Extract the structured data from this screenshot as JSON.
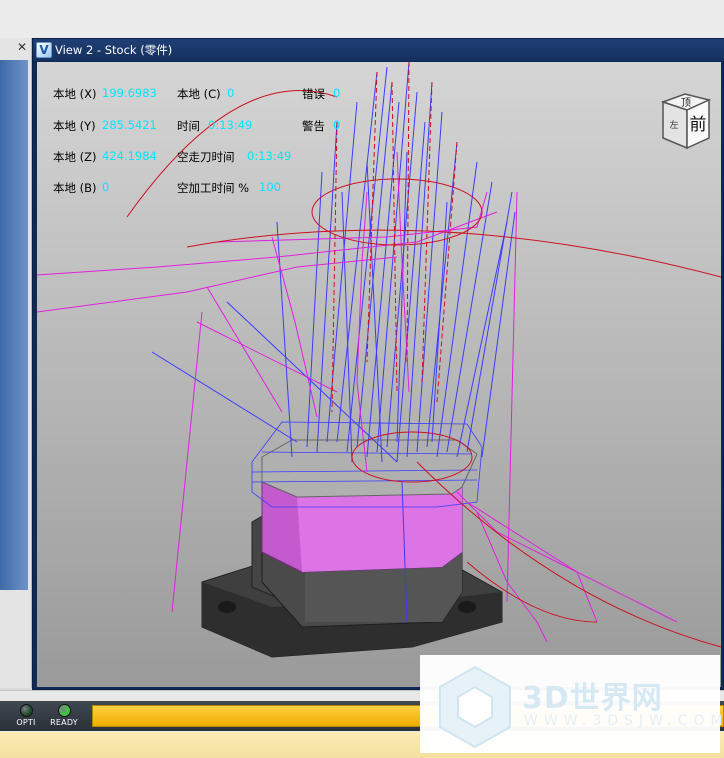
{
  "window": {
    "title": "View 2 - Stock (零件)",
    "icon_name": "vericut-view-icon"
  },
  "readout": {
    "rows": [
      {
        "label": "本地 (X)",
        "value": "199.6983"
      },
      {
        "label": "本地 (Y)",
        "value": "285.5421"
      },
      {
        "label": "本地 (Z)",
        "value": "424.1984"
      },
      {
        "label": "本地 (B)",
        "value": "0"
      }
    ],
    "col2": [
      {
        "label": "本地 (C)",
        "value": "0"
      },
      {
        "label": "时间",
        "value": "0:13:49"
      },
      {
        "label": "空走刀时间",
        "value": "0:13:49"
      },
      {
        "label": "空加工时间 %",
        "value": "100"
      }
    ],
    "col3": [
      {
        "label": "错误",
        "value": "0"
      },
      {
        "label": "警告",
        "value": "0"
      }
    ],
    "value_color": "#00e5ff"
  },
  "view_cube": {
    "top_face": "顶",
    "front_face": "前",
    "side_face": "左"
  },
  "status": {
    "indicators": [
      {
        "label": "OPTI",
        "color": "#1f4a2a"
      },
      {
        "label": "READY",
        "color": "#3ec83e"
      }
    ],
    "progress_fraction": 1.0,
    "progress_color": "#f5b400"
  },
  "watermark": {
    "text": "3D世界网",
    "sub": "WWW.3DSJW.COM"
  },
  "colors": {
    "toolpath_feed": "#3b3bff",
    "toolpath_rapid": "#e020e0",
    "toolpath_arc": "#cc1020",
    "stock_top": "#d966e6",
    "fixture": "#3a3a3a"
  }
}
